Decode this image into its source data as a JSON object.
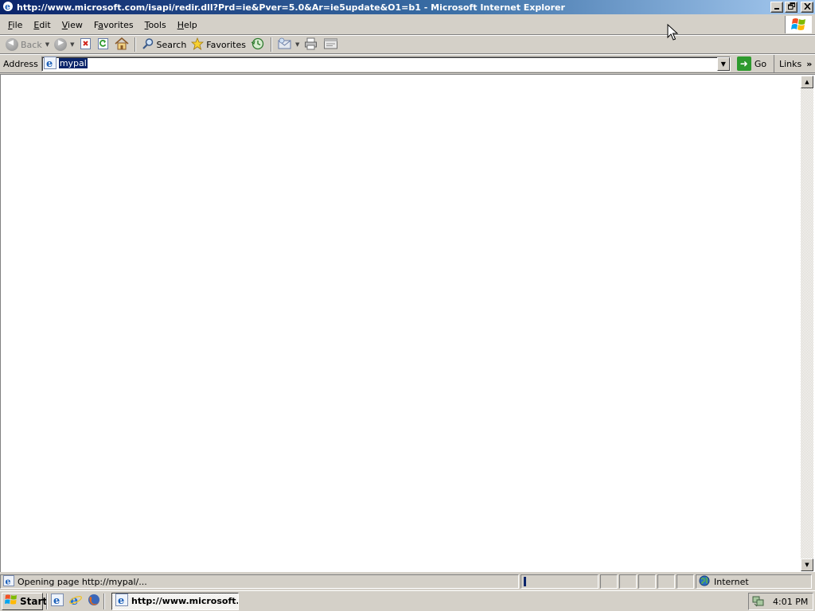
{
  "window": {
    "title": "http://www.microsoft.com/isapi/redir.dll?Prd=ie&Pver=5.0&Ar=ie5update&O1=b1 - Microsoft Internet Explorer",
    "buttons": [
      "minimize-icon",
      "restore-icon",
      "close-icon"
    ]
  },
  "menu": {
    "items": [
      {
        "label": "File",
        "accel": "F"
      },
      {
        "label": "Edit",
        "accel": "E"
      },
      {
        "label": "View",
        "accel": "V"
      },
      {
        "label": "Favorites",
        "accel": "a"
      },
      {
        "label": "Tools",
        "accel": "T"
      },
      {
        "label": "Help",
        "accel": "H"
      }
    ]
  },
  "toolbar": {
    "back_label": "Back",
    "search_label": "Search",
    "favorites_label": "Favorites"
  },
  "address": {
    "label": "Address",
    "value": "mypal",
    "go_label": "Go",
    "links_label": "Links"
  },
  "status": {
    "message": "Opening page http://mypal/...",
    "zone": "Internet"
  },
  "taskbar": {
    "start_label": "Start",
    "task_label": "http://www.microsoft...",
    "clock": "4:01 PM"
  },
  "colors": {
    "title_active": "#0a246a",
    "selection": "#0a246a",
    "face": "#d4d0c8"
  }
}
